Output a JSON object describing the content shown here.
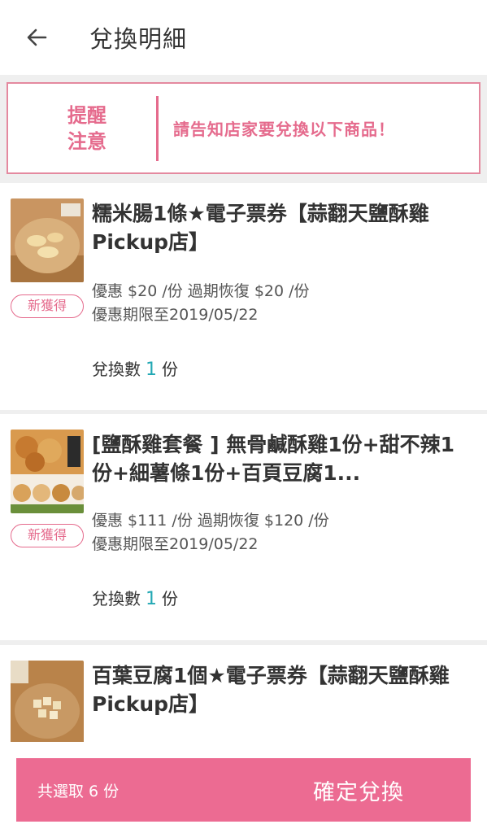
{
  "header": {
    "title": "兌換明細"
  },
  "notice": {
    "label_line1": "提醒",
    "label_line2": "注意",
    "message": "請告知店家要兌換以下商品！"
  },
  "items": [
    {
      "title": "糯米腸1條★電子票券【蒜翻天鹽酥雞 Pickup店】",
      "badge": "新獲得",
      "price_text": "優惠 $20 /份 過期恢復 $20 /份",
      "expiry_text": "優惠期限至2019/05/22",
      "qty_prefix": "兌換數",
      "qty": "1",
      "qty_unit": "份"
    },
    {
      "title": "[鹽酥雞套餐 ] 無骨鹹酥雞1份+甜不辣1份+細薯條1份+百頁豆腐1...",
      "badge": "新獲得",
      "price_text": "優惠 $111 /份 過期恢復 $120 /份",
      "expiry_text": "優惠期限至2019/05/22",
      "qty_prefix": "兌換數",
      "qty": "1",
      "qty_unit": "份"
    },
    {
      "title": "百葉豆腐1個★電子票券【蒜翻天鹽酥雞 Pickup店】"
    }
  ],
  "footer": {
    "selected_text": "共選取 6 份",
    "confirm_label": "確定兌換"
  },
  "colors": {
    "accent": "#ec6b92",
    "notice": "#e56b8d",
    "qty": "#22a8b4"
  }
}
